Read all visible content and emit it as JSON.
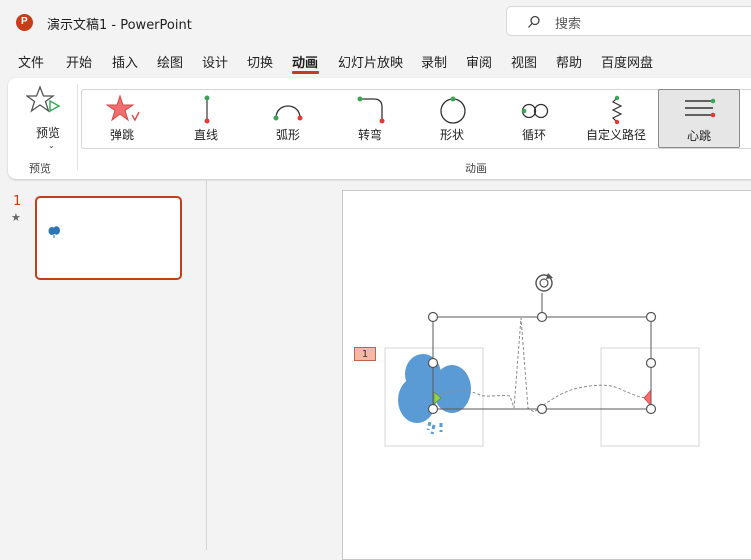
{
  "titlebar": {
    "app_icon_letter": "P",
    "document_title": "演示文稿1  -  PowerPoint",
    "search_placeholder": "搜索"
  },
  "menu": {
    "items": [
      "文件",
      "开始",
      "插入",
      "绘图",
      "设计",
      "切换",
      "动画",
      "幻灯片放映",
      "录制",
      "审阅",
      "视图",
      "帮助",
      "百度网盘"
    ],
    "active": "动画"
  },
  "ribbon": {
    "preview_button": "预览",
    "preview_group_label": "预览",
    "animation_group_label": "动画",
    "animations": [
      {
        "label": "弹跳",
        "icon": "bounce-star-icon"
      },
      {
        "label": "直线",
        "icon": "line-path-icon"
      },
      {
        "label": "弧形",
        "icon": "arc-path-icon"
      },
      {
        "label": "转弯",
        "icon": "turn-path-icon"
      },
      {
        "label": "形状",
        "icon": "shape-path-icon"
      },
      {
        "label": "循环",
        "icon": "loop-path-icon"
      },
      {
        "label": "自定义路径",
        "icon": "custom-path-icon"
      },
      {
        "label": "心跳",
        "icon": "heartbeat-path-icon",
        "selected": true
      }
    ]
  },
  "slides_panel": {
    "slide_number": "1",
    "slide_star": "★"
  },
  "canvas": {
    "animation_badge": "1"
  },
  "colors": {
    "accent": "#c43e1c",
    "balloon": "#5b9bd5",
    "path_start": "#92d050",
    "path_end": "#ff6b6b"
  }
}
